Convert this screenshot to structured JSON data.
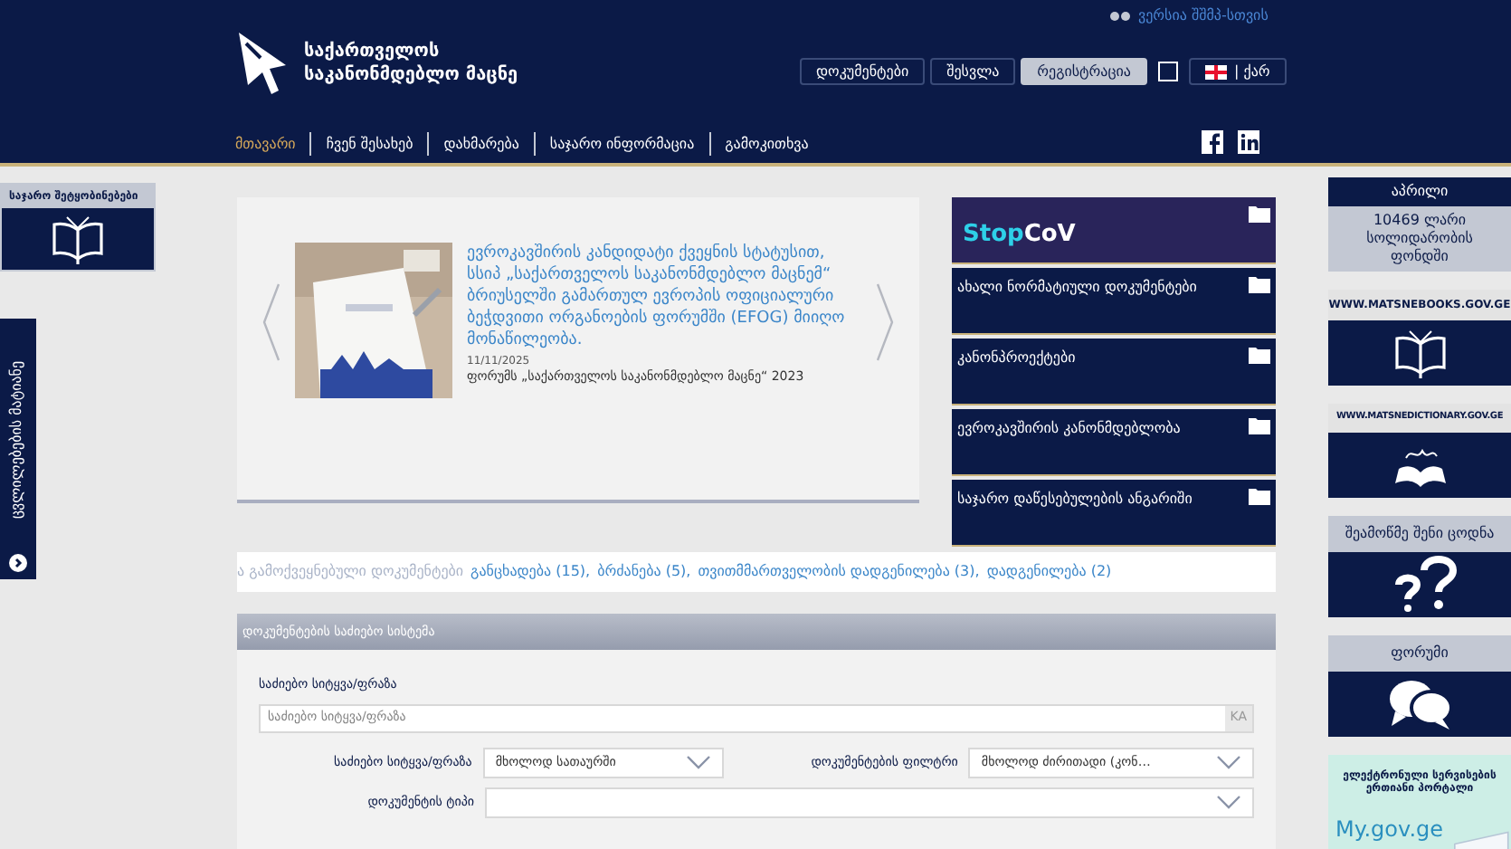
{
  "header": {
    "accessibility_link": "ვერსია შშმპ-სთვის",
    "logo_lines": [
      "საქართველოს",
      "საკანონმდებლო მაცნე"
    ],
    "buttons": [
      {
        "label": "დოკუმენტები",
        "selected": false
      },
      {
        "label": "შესვლა",
        "selected": false
      },
      {
        "label": "რეგისტრაცია",
        "selected": true
      }
    ],
    "checkbox": {
      "checked": false
    },
    "language": "| ქარ"
  },
  "nav": [
    {
      "label": "მთავარი",
      "selected": true
    },
    {
      "label": "ჩვენ შესახებ",
      "selected": false
    },
    {
      "label": "დახმარება",
      "selected": false
    },
    {
      "label": "საჯარო ინფორმაცია",
      "selected": false
    },
    {
      "label": "გამოკითხვა",
      "selected": false
    }
  ],
  "left": {
    "notices_title": "საჯარო შეტყობინებები",
    "vertical_tab": "ცვლილებების მატიანე"
  },
  "carousel": {
    "headline": "ევროკავშირის კანდიდატი ქვეყნის სტატუსით, სსიპ „საქართველოს საკანონმდებლო მაცნემ“ ბრიუსელში გამართულ ევროპის ოფიციალური ბეჭდვითი ორგანოების ფორუმში (EFOG) მიიღო მონაწილეობა.",
    "date": "11/11/2025",
    "summary": "ფორუმს „საქართველოს საკანონმდებლო მაცნე“ 2023"
  },
  "menu": [
    {
      "kind": "logo",
      "label_a": "Stop",
      "label_b": "CoV"
    },
    {
      "kind": "text",
      "label": "ახალი ნორმატიული დოკუმენტები"
    },
    {
      "kind": "text",
      "label": "კანონპროექტები"
    },
    {
      "kind": "text",
      "label": "ევროკავშირის კანონმდებლობა"
    },
    {
      "kind": "text",
      "label": "საჯარო დაწესებულების ანგარიში"
    }
  ],
  "ticker": {
    "lead": "ა გამოქვეყნებული დოკუმენტები",
    "links": [
      "განცხადება (15),",
      "ბრძანება (5),",
      "თვითმმართველობის დადგენილება (3),",
      "დადგენილება (2)"
    ]
  },
  "search": {
    "title": "დოკუმენტების საძიებო სისტემა",
    "keyword_label": "საძიებო სიტყვა/ფრაზა",
    "keyword_placeholder": "საძიებო სიტყვა/ფრაზა",
    "keyboard_button": "KA",
    "rows": [
      {
        "label": "საძიებო სიტყვა/ფრაზა",
        "value": "მხოლოდ სათაურში",
        "label2": "დოკუმენტების ფილტრი",
        "value2": "მხოლოდ ძირითადი (კონ…"
      },
      {
        "label": "დოკუმენტის ტიპი",
        "value": ""
      }
    ]
  },
  "sidebar": [
    {
      "kind": "fund",
      "title": "აპრილი",
      "text": "10469 ლარი სოლიდარობის ფონდში"
    },
    {
      "kind": "books",
      "title": "WWW.MATSNEBOOKS.GOV.GE"
    },
    {
      "kind": "dictionary",
      "title": "WWW.MATSNEDICTIONARY.GOV.GE"
    },
    {
      "kind": "quiz",
      "title": "შეამოწმე შენი ცოდნა"
    },
    {
      "kind": "forum",
      "title": "ფორუმი"
    },
    {
      "kind": "portal",
      "title": "ელექტრონული სერვისების ერთიანი პორტალი",
      "text": "My.gov.ge"
    }
  ]
}
